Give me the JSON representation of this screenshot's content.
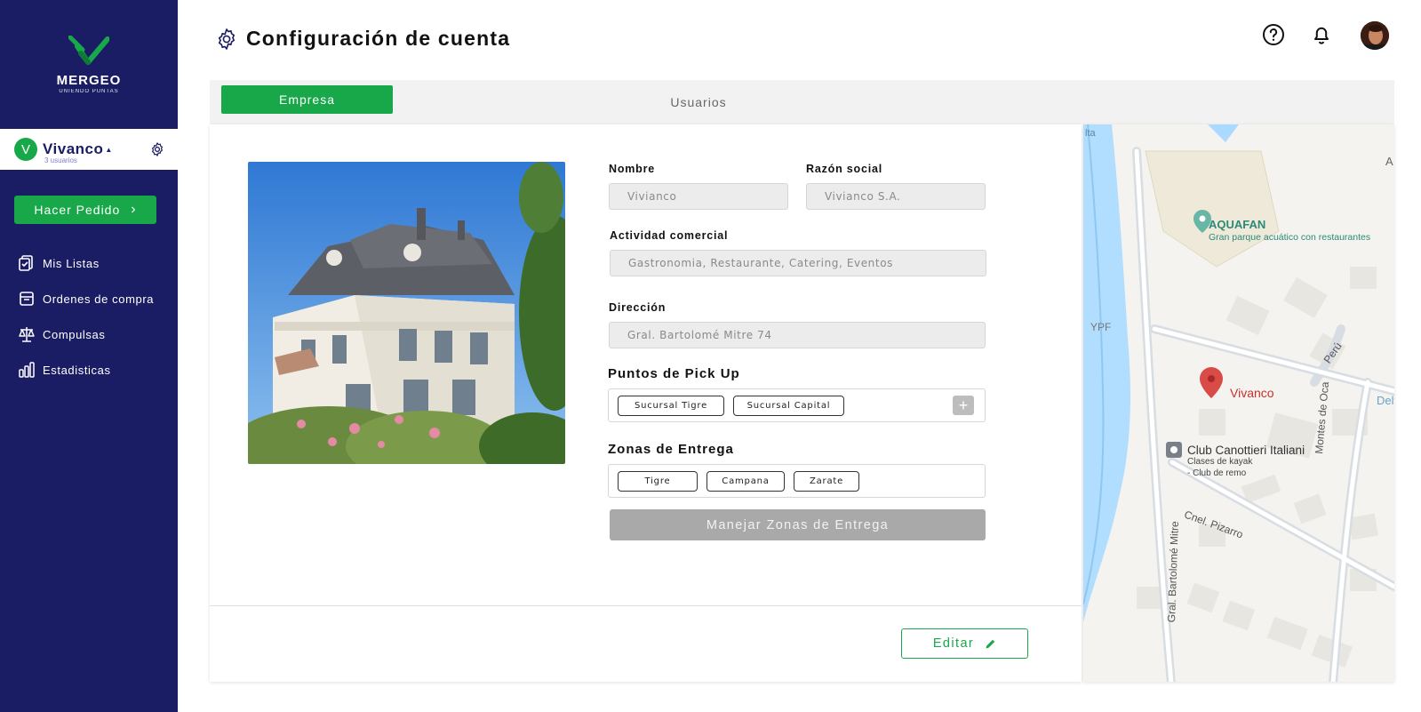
{
  "app": {
    "brand": "MERGEO",
    "brand_tagline": "UNIENDO PUNTAS"
  },
  "account": {
    "initial": "V",
    "name": "Vivanco",
    "sub": "3 usuarios"
  },
  "sidebar": {
    "order_button": "Hacer Pedido",
    "items": [
      {
        "label": "Mis Listas",
        "icon": "list-icon"
      },
      {
        "label": "Ordenes de compra",
        "icon": "orders-icon"
      },
      {
        "label": "Compulsas",
        "icon": "scale-icon"
      },
      {
        "label": "Estadisticas",
        "icon": "stats-icon"
      }
    ]
  },
  "header": {
    "title": "Configuración de cuenta"
  },
  "tabs": [
    {
      "label": "Empresa",
      "active": true
    },
    {
      "label": "Usuarios",
      "active": false
    }
  ],
  "form": {
    "nombre": {
      "label": "Nombre",
      "value": "Vivianco"
    },
    "razon_social": {
      "label": "Razón social",
      "value": "Vivianco S.A."
    },
    "actividad": {
      "label": "Actividad comercial",
      "value": "Gastronomia, Restaurante, Catering, Eventos"
    },
    "direccion": {
      "label": "Dirección",
      "value": "Gral. Bartolomé Mitre 74"
    },
    "pickup": {
      "label": "Puntos de Pick Up",
      "chips": [
        "Sucursal Tigre",
        "Sucursal Capital"
      ],
      "add": "+"
    },
    "zonas": {
      "label": "Zonas de Entrega",
      "chips": [
        "Tigre",
        "Campana",
        "Zarate"
      ]
    },
    "manage_button": "Manejar Zonas de Entrega",
    "edit_button": "Editar"
  },
  "map": {
    "place_1_title": "AQUAFAN",
    "place_1_sub": "Gran parque acuático con restaurantes",
    "pin_label": "Vivanco",
    "club_title": "Club Canottieri Italiani",
    "club_sub_1": "Clases de kayak",
    "club_sub_2": "- Club de remo",
    "ypf": "YPF",
    "street_1": "Perú",
    "street_2": "Montes de Oca",
    "street_3": "Cnel. Pizarro",
    "street_4": "Gral. Bartolomé Mitre",
    "edge_1": "Delt",
    "edge_2": "A",
    "edge_3": "lta"
  },
  "colors": {
    "sidebar": "#1a1d63",
    "accent_green": "#18a84a",
    "disabled_button": "#a9a9a9"
  }
}
